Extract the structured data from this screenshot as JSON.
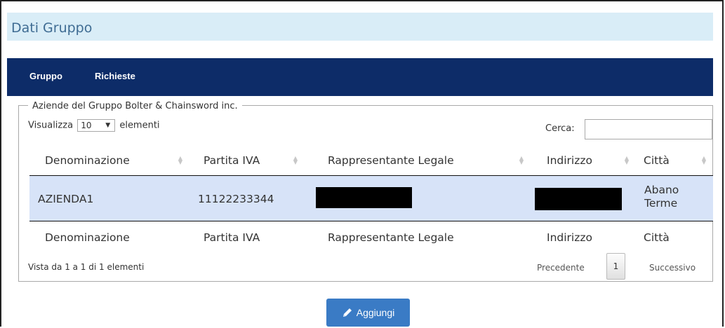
{
  "page": {
    "title": "Dati Gruppo"
  },
  "nav": {
    "items": [
      "Gruppo",
      "Richieste"
    ]
  },
  "fieldset": {
    "legend": "Aziende del Gruppo Bolter & Chainsword inc."
  },
  "length_control": {
    "prefix": "Visualizza",
    "selected": "10",
    "suffix": "elementi"
  },
  "search": {
    "label": "Cerca:",
    "value": ""
  },
  "table": {
    "columns": [
      "Denominazione",
      "Partita IVA",
      "Rappresentante Legale",
      "Indirizzo",
      "Città"
    ],
    "rows": [
      {
        "denominazione": "AZIENDA1",
        "partita_iva": "11122233344",
        "rappresentante_legale": "[redacted]",
        "indirizzo": "[redacted]",
        "citta": [
          "Abano",
          "Terme"
        ]
      }
    ],
    "footer": [
      "Denominazione",
      "Partita IVA",
      "Rappresentante Legale",
      "Indirizzo",
      "Città"
    ]
  },
  "pagination": {
    "info": "Vista da 1 a 1 di 1 elementi",
    "prev": "Precedente",
    "page": "1",
    "next": "Successivo"
  },
  "actions": {
    "add_label": "Aggiungi",
    "add_icon": "pencil-icon"
  },
  "colors": {
    "header_bg": "#d9edf7",
    "navbar_bg": "#0d2c68",
    "row_selected": "#d7e3f8",
    "button": "#3a7bc5"
  }
}
